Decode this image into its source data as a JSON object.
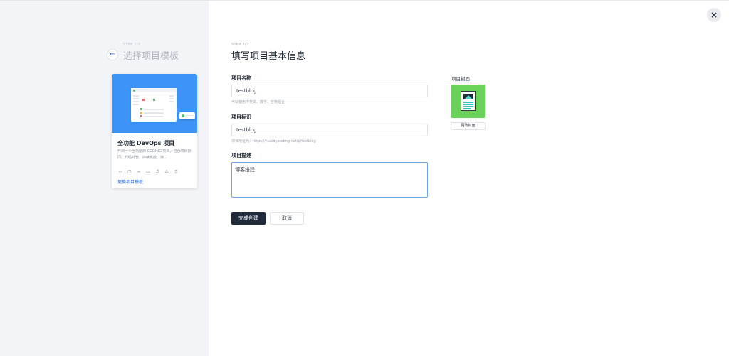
{
  "close": {
    "icon": "close-icon",
    "glyph": "×"
  },
  "left": {
    "back_icon": "arrow-left-icon",
    "back_glyph": "←",
    "step_label": "STEP 1/2",
    "title": "选择项目模板",
    "template": {
      "name": "全功能 DevOps 项目",
      "description": "开启一个全功能的 CODING 项目，包含项目协同、代码托管、持续集成、持...",
      "icons": [
        "code-icon",
        "screen-icon",
        "link-icon",
        "browser-icon",
        "bell-icon",
        "warning-icon",
        "mobile-icon"
      ],
      "icon_glyphs": [
        "‹›",
        "▢",
        "∞",
        "▭",
        "♫",
        "⚠",
        "▯"
      ],
      "change_link": "更换项目模板"
    }
  },
  "form": {
    "step_label": "STEP 2/2",
    "title": "填写项目基本信息",
    "name_label": "项目名称",
    "name_value": "testblog",
    "name_hint": "可以使用中英文、数字、空格组合",
    "id_label": "项目标识",
    "id_value": "testblog",
    "id_hint": "项目地址为：https://kuaidy.coding.net/p/testblog",
    "desc_label": "项目描述",
    "desc_value": "博客搭建",
    "cover_label": "项目封面",
    "cover_button": "更改封面",
    "submit_button": "完成创建",
    "cancel_button": "取消"
  },
  "colors": {
    "accent": "#2a6ae0",
    "primary_button": "#1f2a3a",
    "template_cover": "#3d94f6",
    "project_cover": "#6ad15b"
  }
}
